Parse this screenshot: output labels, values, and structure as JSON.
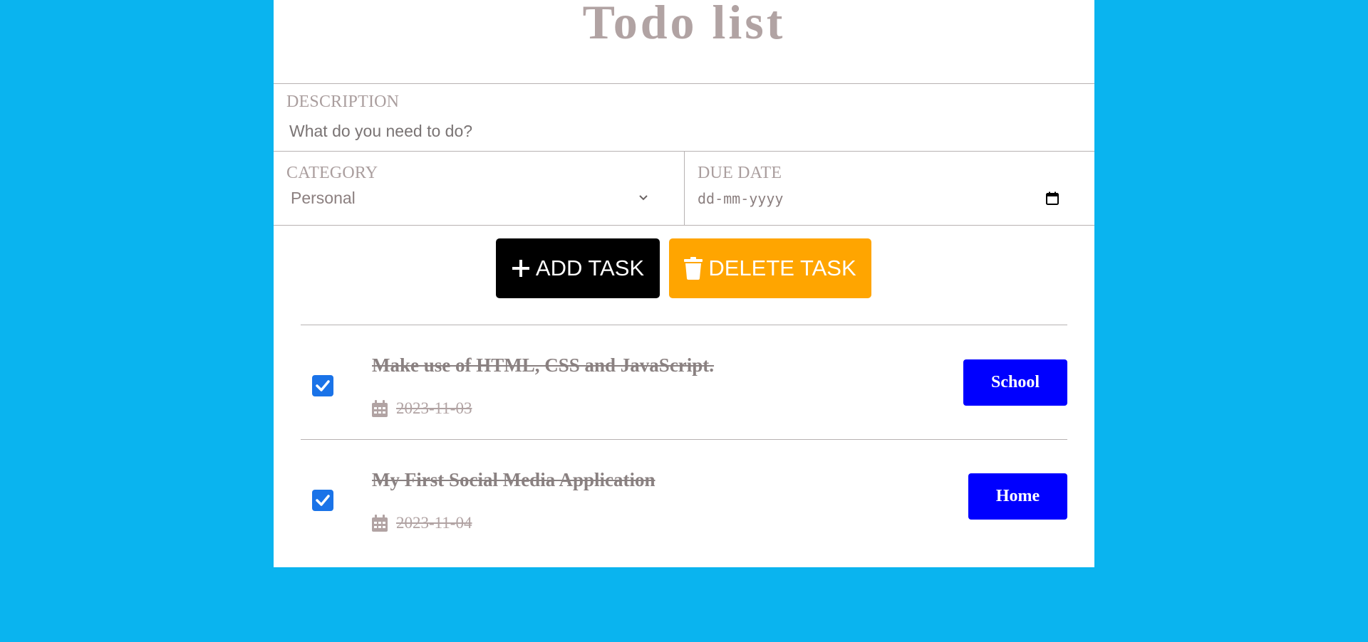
{
  "app": {
    "title": "Todo list"
  },
  "form": {
    "description": {
      "label": "DESCRIPTION",
      "placeholder": "What do you need to do?"
    },
    "category": {
      "label": "CATEGORY",
      "selected": "Personal"
    },
    "due_date": {
      "label": "DUE DATE",
      "placeholder": "dd-mm-yyyy"
    }
  },
  "actions": {
    "add_label": "ADD TASK",
    "delete_label": "DELETE TASK"
  },
  "tasks": [
    {
      "text": "Make use of HTML, CSS and JavaScript.",
      "date": "2023-11-03",
      "category": "School",
      "done": true
    },
    {
      "text": "My First Social Media Application",
      "date": "2023-11-04",
      "category": "Home",
      "done": true
    }
  ],
  "colors": {
    "page_background": "#0ab4ef",
    "add_button": "#000000",
    "delete_button": "#ffa500",
    "category_badge": "#0000ff",
    "checkbox": "#1a73e8"
  },
  "icons": {
    "add": "plus-icon",
    "delete": "trash-icon",
    "date": "calendar-icon",
    "select": "chevron-down-icon",
    "check": "checkmark-icon"
  }
}
